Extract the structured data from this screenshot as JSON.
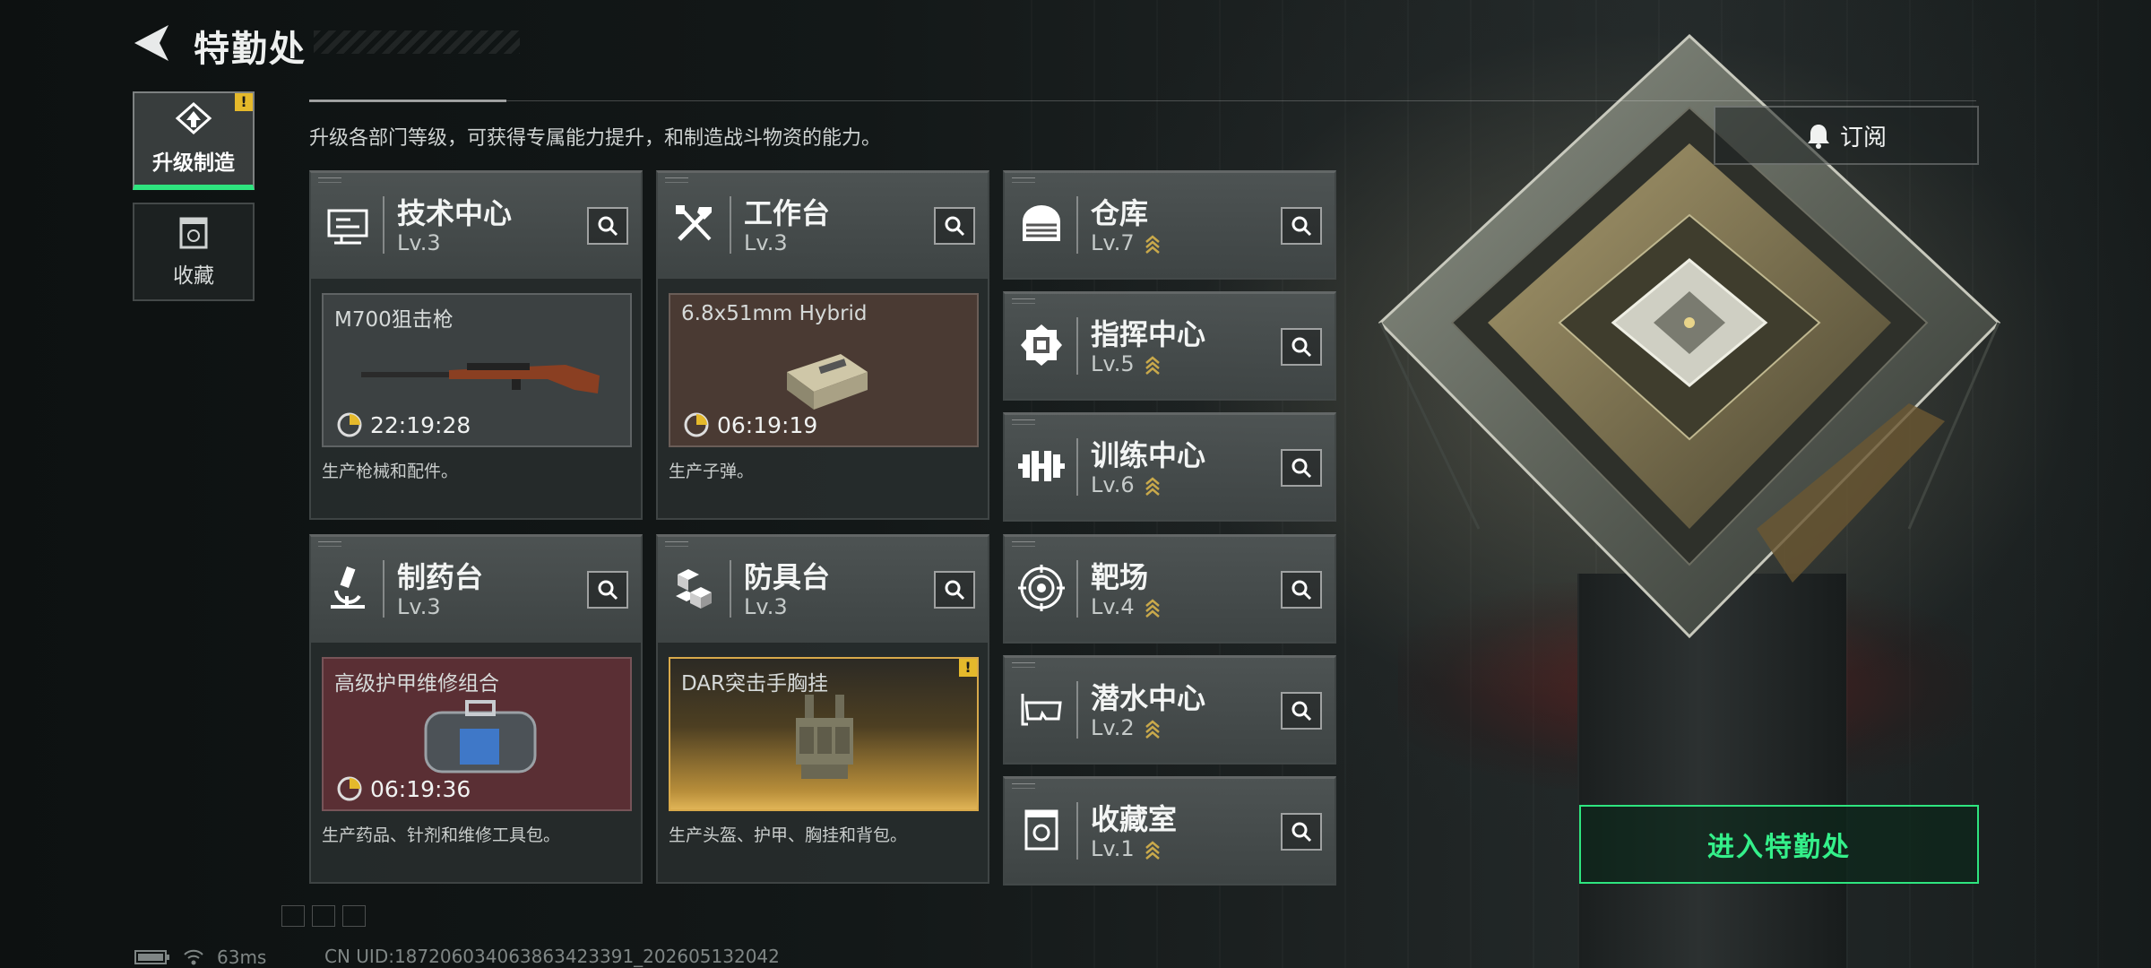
{
  "header": {
    "title": "特勤处"
  },
  "sidebar": {
    "tabs": [
      {
        "label": "升级制造",
        "active": true,
        "badge": "!"
      },
      {
        "label": "收藏",
        "active": false
      }
    ]
  },
  "description": "升级各部门等级，可获得专属能力提升，和制造战斗物资的能力。",
  "subscribe": {
    "label": "订阅"
  },
  "production": [
    {
      "name": "技术中心",
      "level": "Lv.3",
      "item": "M700狙击枪",
      "timer": "22:19:28",
      "caption": "生产枪械和配件。",
      "box_color": "#3c4142"
    },
    {
      "name": "工作台",
      "level": "Lv.3",
      "item": "6.8x51mm Hybrid",
      "timer": "06:19:19",
      "caption": "生产子弹。",
      "box_color": "#4a3a33"
    },
    {
      "name": "制药台",
      "level": "Lv.3",
      "item": "高级护甲维修组合",
      "timer": "06:19:36",
      "caption": "生产药品、针剂和维修工具包。",
      "box_color": "#5a2f34"
    },
    {
      "name": "防具台",
      "level": "Lv.3",
      "item": "DAR突击手胸挂",
      "badge": "!",
      "caption": "生产头盔、护甲、胸挂和背包。",
      "box_color": "#8a6a2e"
    }
  ],
  "departments": [
    {
      "name": "仓库",
      "level": "Lv.7",
      "icon": "warehouse-icon"
    },
    {
      "name": "指挥中心",
      "level": "Lv.5",
      "icon": "command-center-icon"
    },
    {
      "name": "训练中心",
      "level": "Lv.6",
      "icon": "dumbbell-icon"
    },
    {
      "name": "靶场",
      "level": "Lv.4",
      "icon": "target-icon"
    },
    {
      "name": "潜水中心",
      "level": "Lv.2",
      "icon": "diving-mask-icon"
    },
    {
      "name": "收藏室",
      "level": "Lv.1",
      "icon": "collection-room-icon"
    }
  ],
  "enter_button": {
    "label": "进入特勤处"
  },
  "footer": {
    "ping": "63ms",
    "uid": "CN UID:18720603406386342339​1_202605132042"
  },
  "colors": {
    "accent": "#2ee57f",
    "warning": "#e5b92b"
  }
}
